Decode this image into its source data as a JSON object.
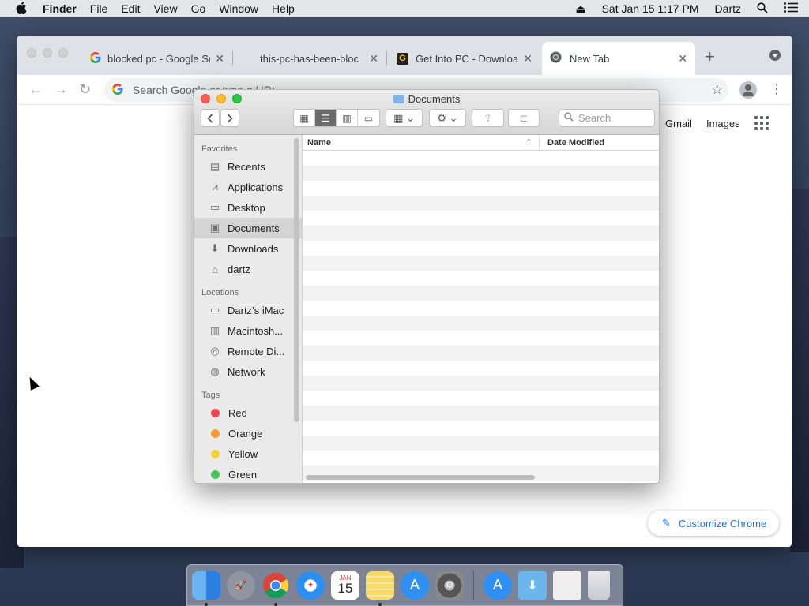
{
  "menubar": {
    "app": "Finder",
    "items": [
      "File",
      "Edit",
      "View",
      "Go",
      "Window",
      "Help"
    ],
    "datetime": "Sat Jan 15  1:17 PM",
    "user": "Dartz"
  },
  "chrome": {
    "tabs": [
      {
        "title": "blocked pc - Google Se",
        "icon": "google-g-icon"
      },
      {
        "title": "this-pc-has-been-bloc",
        "icon": "blank-page-icon"
      },
      {
        "title": "Get Into PC - Downloa",
        "icon": "getintopc-icon"
      },
      {
        "title": "New Tab",
        "icon": "chrome-icon"
      }
    ],
    "omnibox_placeholder": "Search Google or type a URL",
    "ntp": {
      "gmail": "Gmail",
      "images": "Images",
      "customize": "Customize Chrome"
    }
  },
  "finder": {
    "title": "Documents",
    "search_placeholder": "Search",
    "sidebar": {
      "favorites_label": "Favorites",
      "favorites": [
        {
          "label": "Recents",
          "icon": "recents-icon"
        },
        {
          "label": "Applications",
          "icon": "applications-icon"
        },
        {
          "label": "Desktop",
          "icon": "desktop-icon"
        },
        {
          "label": "Documents",
          "icon": "documents-icon",
          "selected": true
        },
        {
          "label": "Downloads",
          "icon": "downloads-icon"
        },
        {
          "label": "dartz",
          "icon": "home-icon"
        }
      ],
      "locations_label": "Locations",
      "locations": [
        {
          "label": "Dartz’s iMac",
          "icon": "imac-icon"
        },
        {
          "label": "Macintosh...",
          "icon": "hard-drive-icon"
        },
        {
          "label": "Remote Di...",
          "icon": "remote-disc-icon"
        },
        {
          "label": "Network",
          "icon": "network-icon"
        }
      ],
      "tags_label": "Tags",
      "tags": [
        {
          "label": "Red",
          "color": "#e8474a"
        },
        {
          "label": "Orange",
          "color": "#f29c38"
        },
        {
          "label": "Yellow",
          "color": "#f5cf3a"
        },
        {
          "label": "Green",
          "color": "#4cc25a"
        }
      ]
    },
    "columns": {
      "name": "Name",
      "date": "Date Modified"
    }
  },
  "dock": {
    "apps": [
      {
        "name": "finder-icon",
        "color": "#3d8fe8",
        "running": true
      },
      {
        "name": "launchpad-icon",
        "color": "#8a8f99",
        "running": false
      },
      {
        "name": "chrome-icon",
        "color": "#ffffff",
        "running": true
      },
      {
        "name": "safari-icon",
        "color": "#2a8ff0",
        "running": false
      },
      {
        "name": "calendar-icon",
        "color": "#ffffff",
        "running": false
      },
      {
        "name": "notes-icon",
        "color": "#f6d968",
        "running": true
      },
      {
        "name": "app-store-icon",
        "color": "#2e8ff5",
        "running": false
      },
      {
        "name": "system-preferences-icon",
        "color": "#7d7d7d",
        "running": false
      },
      {
        "name": "app-store-folder-icon",
        "color": "#2e8ff5",
        "running": false
      },
      {
        "name": "downloads-stack-icon",
        "color": "#6cb6ee",
        "running": false
      },
      {
        "name": "documents-stack-icon",
        "color": "#eeeeee",
        "running": false
      },
      {
        "name": "trash-icon",
        "color": "#d6d9dd",
        "running": false
      }
    ],
    "calendar_month": "JAN",
    "calendar_day": "15"
  }
}
